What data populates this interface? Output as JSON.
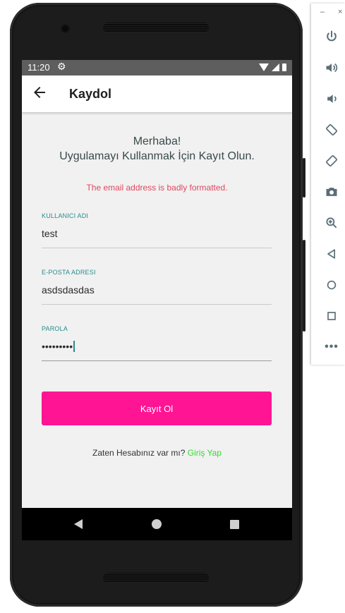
{
  "status_bar": {
    "time": "11:20"
  },
  "app_bar": {
    "title": "Kaydol"
  },
  "greeting": {
    "line1": "Merhaba!",
    "line2": "Uygulamayı Kullanmak İçin Kayıt Olun."
  },
  "error_message": "The email address is badly formatted.",
  "fields": {
    "username": {
      "label": "KULLANICI ADI",
      "value": "test"
    },
    "email": {
      "label": "E-POSTA ADRESI",
      "value": "asdsdasdas"
    },
    "password": {
      "label": "PAROLA",
      "value": "•••••••••"
    }
  },
  "submit_label": "Kayıt Ol",
  "footer": {
    "text": "Zaten Hesabınız var mı?",
    "link": "Giriş Yap"
  },
  "toolbar": {
    "minimize": "–",
    "close": "×",
    "more": "•••"
  },
  "colors": {
    "accent": "#ff1493",
    "link": "#2ee02e",
    "error": "#e0485f",
    "label": "#2a8c8c"
  },
  "icons": [
    "power-icon",
    "volume-up-icon",
    "volume-down-icon",
    "rotate-left-icon",
    "rotate-right-icon",
    "camera-icon",
    "zoom-icon",
    "back-icon",
    "home-icon",
    "overview-icon",
    "more-icon"
  ]
}
